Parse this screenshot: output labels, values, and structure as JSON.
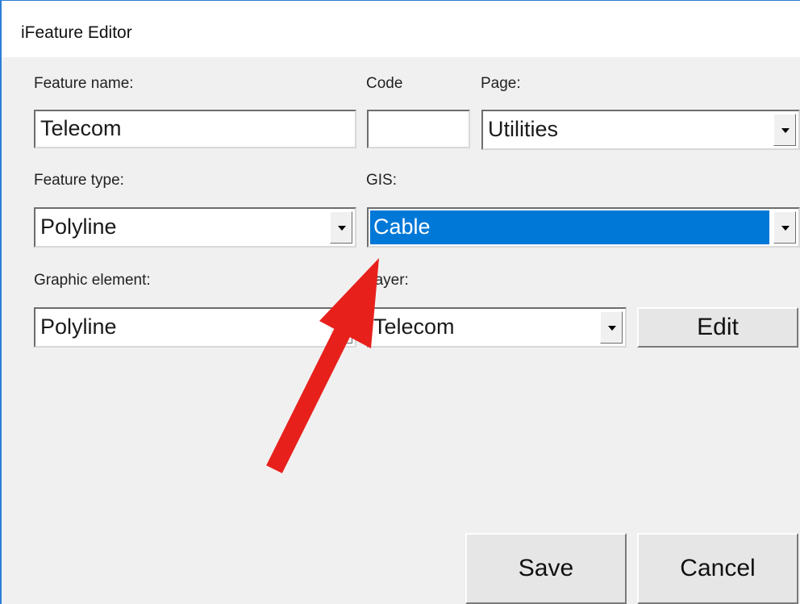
{
  "window": {
    "title": "iFeature Editor"
  },
  "fields": {
    "feature_name": {
      "label": "Feature name:",
      "value": "Telecom"
    },
    "code": {
      "label": "Code",
      "value": ""
    },
    "page": {
      "label": "Page:",
      "value": "Utilities"
    },
    "feature_type": {
      "label": "Feature type:",
      "value": "Polyline"
    },
    "gis": {
      "label": "GIS:",
      "value": "Cable"
    },
    "graphic_element": {
      "label": "Graphic element:",
      "value": "Polyline"
    },
    "layer": {
      "label": "Layer:",
      "value": "Telecom"
    }
  },
  "buttons": {
    "edit": "Edit",
    "save": "Save",
    "cancel": "Cancel"
  },
  "annotation": {
    "arrow_color": "#e8201c"
  },
  "colors": {
    "selection": "#0078d7",
    "window_border": "#2b7fd6",
    "dialog_bg": "#f0f0f0"
  }
}
